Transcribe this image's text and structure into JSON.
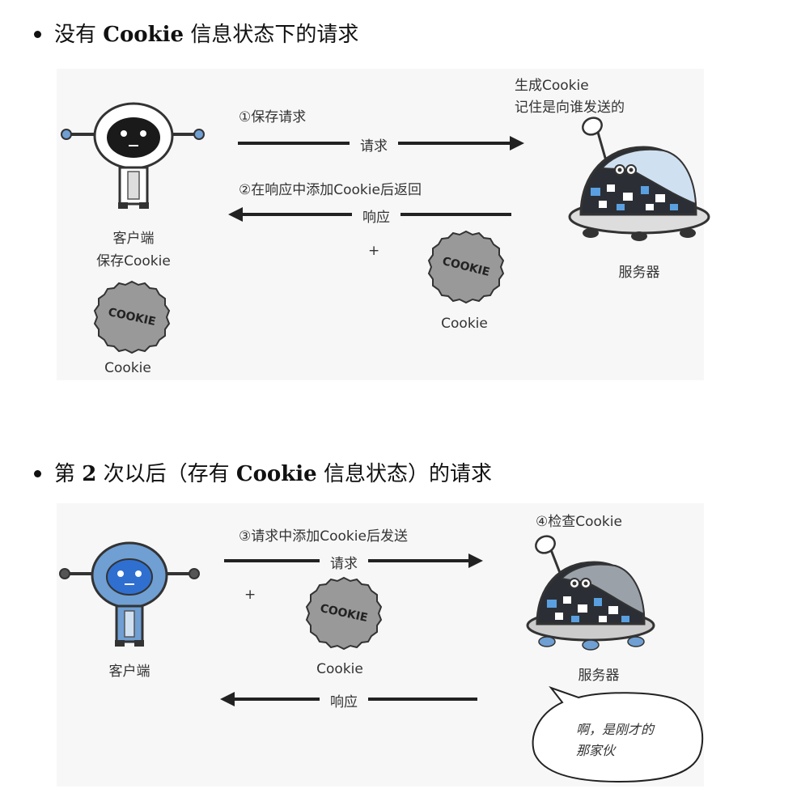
{
  "section1": {
    "heading_pre": "没有 ",
    "heading_bold": "Cookie",
    "heading_post": " 信息状态下的请求",
    "client_label": "客户端",
    "client_save": "保存Cookie",
    "client_cookie_label": "Cookie",
    "step1": "①保存请求",
    "request_label": "请求",
    "step2": "②在响应中添加Cookie后返回",
    "response_label": "响应",
    "plus": "+",
    "response_cookie_label": "Cookie",
    "server_note_line1": "生成Cookie",
    "server_note_line2": "记住是向谁发送的",
    "server_label": "服务器"
  },
  "section2": {
    "heading_pre": "第 ",
    "heading_bold": "2",
    "heading_post": " 次以后（存有 ",
    "heading_bold2": "Cookie",
    "heading_post2": " 信息状态）的请求",
    "client_label": "客户端",
    "step3": "③请求中添加Cookie后发送",
    "request_label": "请求",
    "plus": "+",
    "cookie_label": "Cookie",
    "step4": "④检查Cookie",
    "server_label": "服务器",
    "response_label": "响应",
    "bubble_line1": "啊，是刚才的",
    "bubble_line2": "那家伙"
  },
  "cookie_text": "COOKIE",
  "colors": {
    "robot_dark": "#1a1a1a",
    "robot_blue": "#6f9fd3",
    "server_dome_light": "#cfe0f1",
    "server_dome_dark": "#3a3f45",
    "cookie_fill": "#999999",
    "panel_bg": "#f7f7f7"
  }
}
